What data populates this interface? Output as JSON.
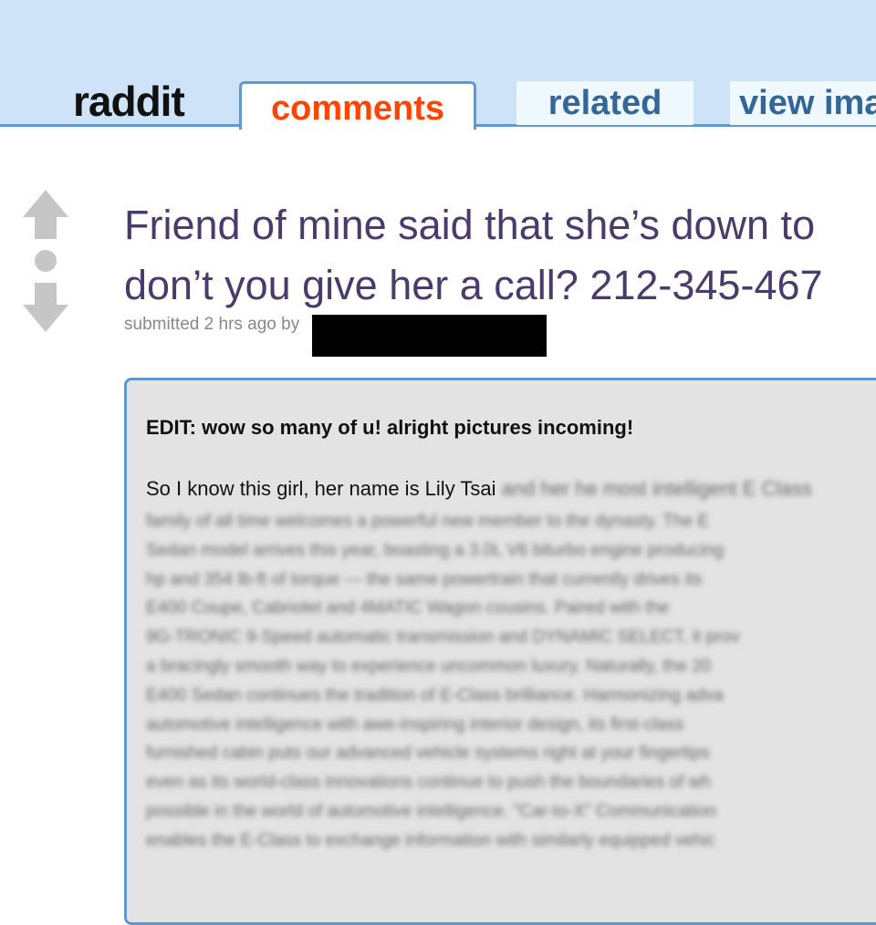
{
  "header": {
    "logo": "raddit",
    "tabs": [
      {
        "label": "comments",
        "active": true
      },
      {
        "label": "related",
        "active": false
      },
      {
        "label": "view ima",
        "active": false
      }
    ]
  },
  "post": {
    "title_lines": [
      "Friend of mine said that she’s down to",
      "don’t you give her a call? 212-345-467"
    ],
    "tagline": "submitted 2 hrs ago by",
    "body": {
      "edit": "EDIT: wow so many of u! alright pictures incoming!",
      "intro": "So I know this girl, her name is Lily Tsai",
      "blurred_tail": "and her he most intelligent E Class",
      "blurred_lines": [
        "family of all time welcomes a powerful new member to the dynasty. The E",
        "Sedan model arrives this year, boasting a 3.0L V6 biturbo engine producing",
        "hp and 354 lb-ft of torque — the same powertrain that currently drives its",
        "E400 Coupe, Cabriolet and 4MATIC Wagon cousins. Paired with the",
        "9G-TRONIC 9-Speed automatic transmission and DYNAMIC SELECT, it prov",
        "a bracingly smooth way to experience uncommon luxury. Naturally, the 20",
        "E400 Sedan continues the tradition of E-Class brilliance. Harmonizing adva",
        "automotive intelligence with awe-inspiring interior design, its first-class",
        "furnished cabin puts our advanced vehicle systems right at your fingertips",
        "even as its world-class innovations continue to push the boundaries of wh",
        "possible in the world of automotive intelligence. \"Car-to-X\" Communication",
        "enables the E-Class to exchange information with similarly equipped vehic"
      ]
    }
  },
  "colors": {
    "header_bg": "#cee3f8",
    "header_border": "#5f99cf",
    "active_tab_text": "#ff4500",
    "tab_text": "#336699",
    "title": "#4a3b6b",
    "body_bg": "#e3e3e3"
  },
  "icons": [
    "upvote-arrow-icon",
    "downvote-arrow-icon"
  ]
}
